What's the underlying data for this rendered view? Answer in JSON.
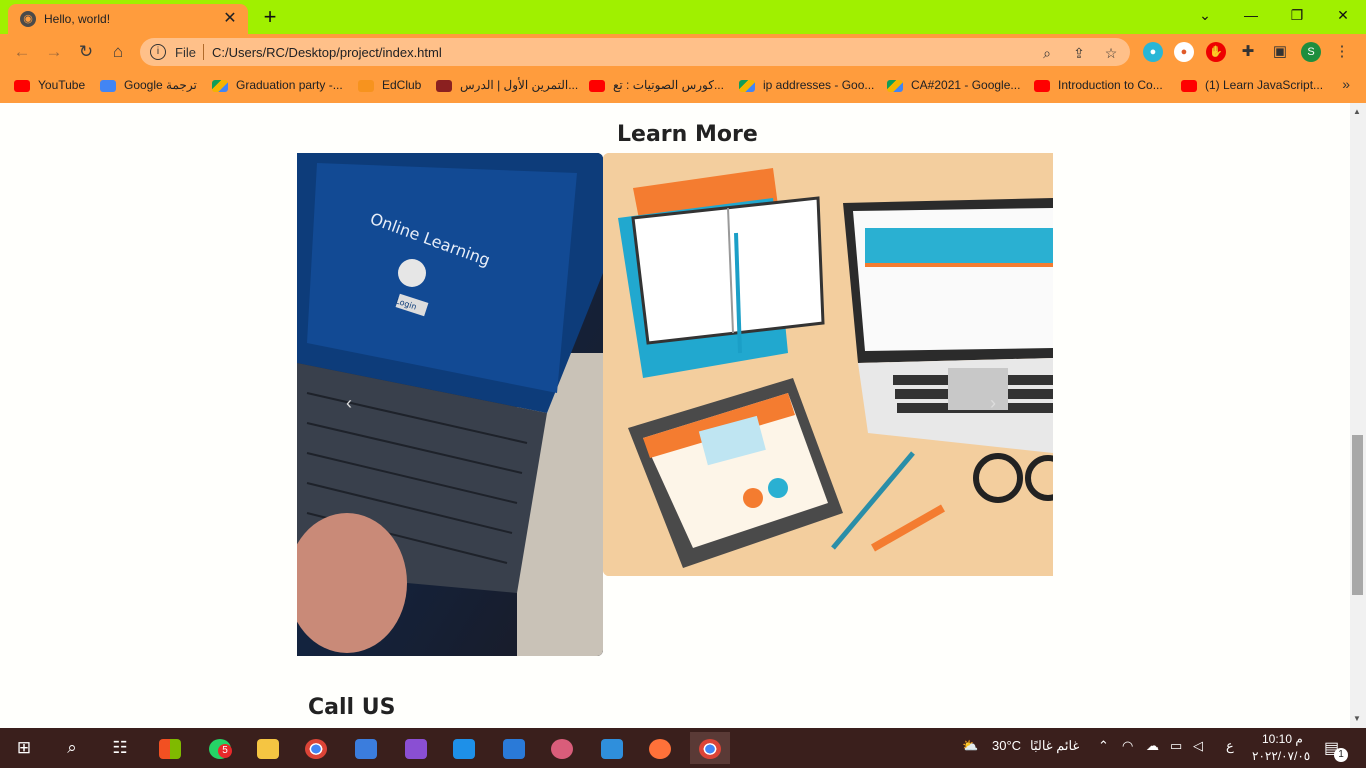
{
  "browser": {
    "tab_title": "Hello, world!",
    "file_label": "File",
    "url": "C:/Users/RC/Desktop/project/index.html",
    "profile_initial": "S",
    "bookmarks": [
      {
        "label": "YouTube",
        "icon": "youtube"
      },
      {
        "label": "Google ترجمة",
        "icon": "google-translate"
      },
      {
        "label": "Graduation party -...",
        "icon": "google-drive"
      },
      {
        "label": "EdClub",
        "icon": "edclub"
      },
      {
        "label": "التمرين الأول | الدرس...",
        "icon": "avatar"
      },
      {
        "label": "كورس الصوتيات : تع...",
        "icon": "youtube"
      },
      {
        "label": "ip addresses - Goo...",
        "icon": "google-drive"
      },
      {
        "label": "CA#2021 - Google...",
        "icon": "google-drive"
      },
      {
        "label": "Introduction to Co...",
        "icon": "youtube"
      },
      {
        "label": "(1) Learn JavaScript...",
        "icon": "youtube"
      }
    ],
    "bookmarks_more": "»"
  },
  "page": {
    "learn_more": "Learn More",
    "image1_text": "Online Learning",
    "image1_login": "Login",
    "call_us": "Call US"
  },
  "taskbar": {
    "whatsapp_badge": "5",
    "temperature": "30°C",
    "weather": "غائم غالبًا",
    "lang": "ع",
    "time": "م 10:10",
    "date": "٢٠٢٢/٠٧/٠٥",
    "notifications": "1"
  },
  "colors": {
    "tabbar": "#a0f000",
    "chrome": "#ff9c3d",
    "omnibox": "#ffc089",
    "taskbar": "#3a1f1c"
  }
}
